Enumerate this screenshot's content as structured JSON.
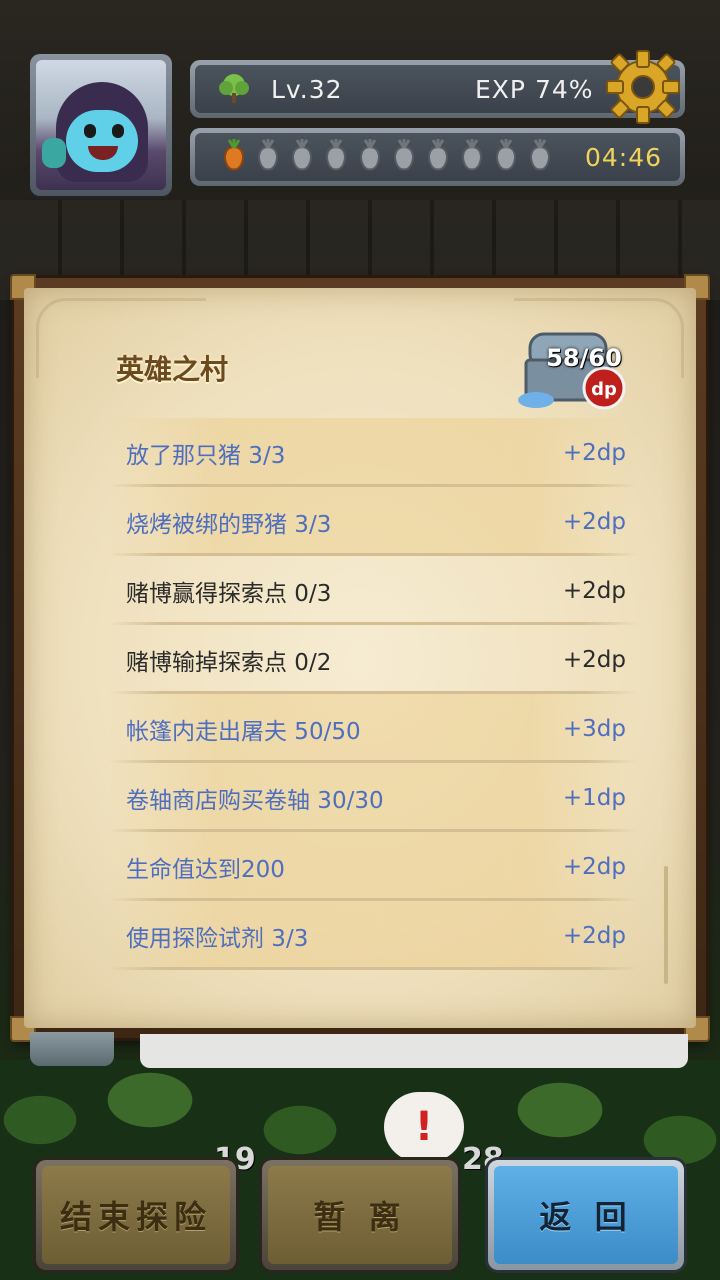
{
  "header": {
    "level": "Lv.32",
    "exp": "EXP 74%",
    "exp_percent": 74,
    "timer": "04:46",
    "stamina": {
      "filled": 1,
      "total": 10
    }
  },
  "panel": {
    "title": "英雄之村",
    "dp_count": "58/60",
    "items": [
      {
        "label": "放了那只猪 3/3",
        "reward": "+2dp",
        "completed": true
      },
      {
        "label": "烧烤被绑的野猪 3/3",
        "reward": "+2dp",
        "completed": true
      },
      {
        "label": "赌博赢得探索点 0/3",
        "reward": "+2dp",
        "completed": false
      },
      {
        "label": "赌博输掉探索点 0/2",
        "reward": "+2dp",
        "completed": false
      },
      {
        "label": "帐篷内走出屠夫 50/50",
        "reward": "+3dp",
        "completed": true
      },
      {
        "label": "卷轴商店购买卷轴 30/30",
        "reward": "+1dp",
        "completed": true
      },
      {
        "label": "生命值达到200",
        "reward": "+2dp",
        "completed": true
      },
      {
        "label": "使用探险试剂 3/3",
        "reward": "+2dp",
        "completed": true
      }
    ]
  },
  "hud": {
    "left_number": "19",
    "right_number": "28",
    "alert": "!"
  },
  "buttons": {
    "end": "结束探险",
    "pause": "暂 离",
    "back": "返 回"
  },
  "colors": {
    "completed_text": "#4e6fbf",
    "pending_text": "#2b2b2b",
    "timer": "#f1d35a"
  }
}
